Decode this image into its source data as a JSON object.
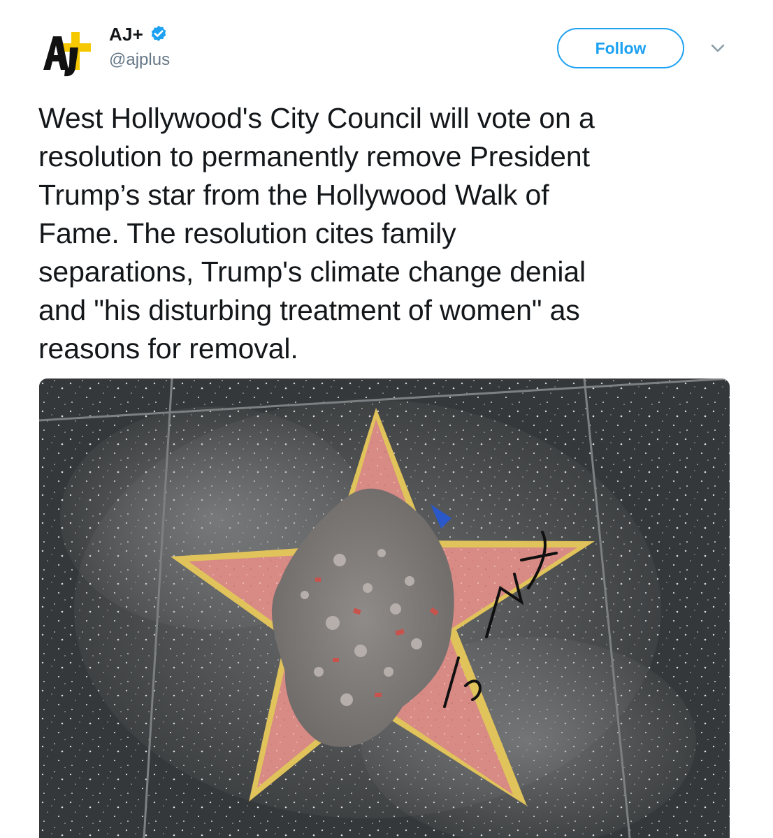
{
  "tweet": {
    "author": {
      "display_name": "AJ+",
      "handle": "@ajplus",
      "verified": true,
      "avatar_icon": "aj-plus-logo-icon",
      "verified_icon": "verified-badge-icon"
    },
    "follow_label": "Follow",
    "menu_icon": "chevron-down-icon",
    "text": "West Hollywood's City Council will vote on a\nresolution to permanently remove President\nTrump’s star from the Hollywood Walk of\nFame. The resolution cites family\nseparations, Trump's climate change denial\nand \"his disturbing treatment of women\" as\nreasons for removal.",
    "media": {
      "type": "photo",
      "subject": "vandalized-walk-of-fame-star"
    }
  },
  "colors": {
    "accent": "#1da1f2",
    "text": "#14171a",
    "secondary_text": "#657786",
    "logo_yellow": "#f6c800",
    "star_pink": "#d9837d",
    "star_border": "#e0c35a"
  }
}
